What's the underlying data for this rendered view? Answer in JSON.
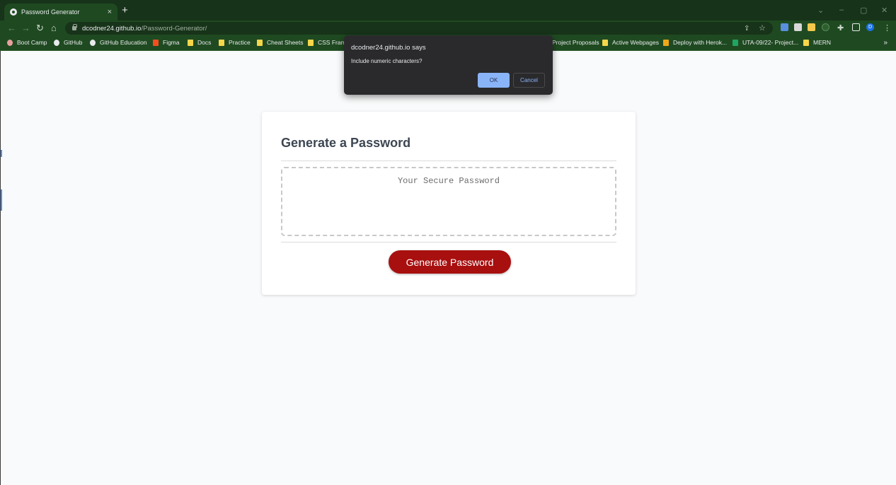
{
  "browser": {
    "tab_title": "Password Generator",
    "tab_close": "×",
    "new_tab": "+",
    "url_host": "dcodner24.github.io",
    "url_path": "/Password-Generator/",
    "profile_initial": "D",
    "window_controls": [
      "⌄",
      "–",
      "▢",
      "✕"
    ],
    "bookmarks": [
      {
        "label": "Boot Camp",
        "icon": "boot-camp-icon"
      },
      {
        "label": "GitHub",
        "icon": "github-icon"
      },
      {
        "label": "GitHub Education",
        "icon": "github-icon"
      },
      {
        "label": "Figma",
        "icon": "figma-icon"
      },
      {
        "label": "Docs",
        "icon": "folder-icon"
      },
      {
        "label": "Practice",
        "icon": "folder-icon"
      },
      {
        "label": "Cheat Sheets",
        "icon": "folder-icon"
      },
      {
        "label": "CSS Frame",
        "icon": "folder-icon"
      },
      {
        "label": "Project Proposals",
        "icon": "folder-icon"
      },
      {
        "label": "Active Webpages",
        "icon": "folder-icon"
      },
      {
        "label": "Deploy with Herok...",
        "icon": "heroku-icon"
      },
      {
        "label": "UTA-09/22- Project...",
        "icon": "sheets-icon"
      },
      {
        "label": "MERN",
        "icon": "folder-icon"
      }
    ],
    "bookmarks_more": "»"
  },
  "page": {
    "heading": "Generate a Password",
    "password_placeholder": "Your Secure Password",
    "generate_button": "Generate Password"
  },
  "dialog": {
    "origin": "dcodner24.github.io says",
    "message": "Include numeric characters?",
    "ok_label": "OK",
    "cancel_label": "Cancel"
  },
  "colors": {
    "chrome_dark": "#173319",
    "chrome_toolbar": "#1f4a21",
    "button_red": "#a80f0f",
    "dialog_bg": "#2a2a2c",
    "dialog_accent": "#8ab4f8"
  }
}
